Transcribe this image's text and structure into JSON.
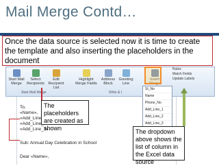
{
  "slide": {
    "title": "Mail Merge Contd…",
    "caption": "Once the data source is selected now it is time to create the template and also inserting the placeholders in the document"
  },
  "ribbon": {
    "buttons": [
      {
        "label": "Start Mail Merge",
        "icon": "start-mail-merge-icon"
      },
      {
        "label": "Select Recipients",
        "icon": "select-recipients-icon"
      },
      {
        "label": "Edit Recipient List",
        "icon": "edit-recipient-list-icon"
      },
      {
        "label": "Highlight Merge Fields",
        "icon": "highlight-fields-icon"
      },
      {
        "label": "Address Block",
        "icon": "address-block-icon"
      },
      {
        "label": "Greeting Line",
        "icon": "greeting-line-icon"
      },
      {
        "label": "Insert Merge Field",
        "icon": "insert-merge-field-icon"
      }
    ],
    "groups": [
      "Start Mail Merge",
      "Write & I"
    ],
    "rules": [
      "Rules",
      "Match Fields",
      "Update Labels"
    ]
  },
  "merge_fields": [
    "St_No",
    "Name",
    "Phone_No",
    "Add_Line_1",
    "Add_Line_2",
    "Add_Line_3"
  ],
  "document": {
    "lines": [
      "To,",
      "«Name»,",
      "«Add_Line_1»,",
      "«Add_Line_2»",
      "«Add_Line_3»",
      "",
      "Sub: Annual Day Celebration in School",
      "",
      "Dear «Name»,"
    ]
  },
  "callouts": {
    "placeholders": "The placeholders are created as shown",
    "dropdown": "The dropdown above shows the list of column in the Excel data source"
  },
  "colors": {
    "accent_red": "#c0282c",
    "title_rule": "#1f497d",
    "highlight": "#f28c28",
    "arrow": "#9ab85e"
  }
}
